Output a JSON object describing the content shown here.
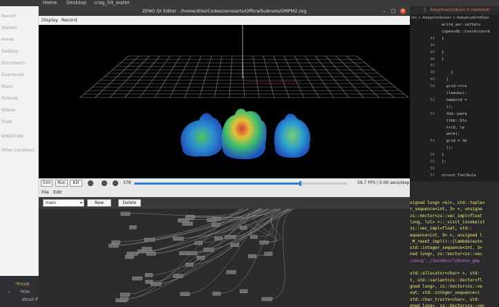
{
  "topbar": {
    "items": [
      "Home",
      "Desktop",
      "crag_hit_water"
    ]
  },
  "file_manager": {
    "places": [
      "Recent",
      "Starred",
      "Home",
      "Desktop",
      "Documents",
      "Downloads",
      "Music",
      "Pictures",
      "Videos",
      "Trash",
      "KINGSTON",
      "Other Locations"
    ],
    "bottom_lines": [
      "\"Primit",
      "Prim",
      "struct P"
    ]
  },
  "zeno_window": {
    "title": "ZENO Qt Editor - /home/dilei/Codes/zeno/arts/OfficialSubnets/GMPM2.zsg",
    "menu": [
      "Display",
      "Record"
    ],
    "timeline": {
      "end_frame": "500",
      "run_label": "Run",
      "kill_label": "Kill",
      "current_frame": "378",
      "progress": 0.78,
      "fps_text": "59.7 FPS | 0.00 secs/step"
    },
    "node_editor": {
      "menu": [
        "File",
        "Edit"
      ],
      "subnet_select": "main",
      "new_label": "New",
      "delete_label": "Delete"
    }
  },
  "code_editor": {
    "tab_title": "AdaptiveGridGen.h (deleted)",
    "breadcrumb": "cts > AdaptiveSolver > AdaptiveGridGen",
    "lines": [
      {
        "num": "",
        "text": "write_axr.setValu"
      },
      {
        "num": "",
        "text": "(openvdb::Coord(coord"
      },
      {
        "num": "43",
        "text": "}"
      },
      {
        "num": "44",
        "text": ""
      },
      {
        "num": "45",
        "text": "}"
      },
      {
        "num": "46",
        "text": "}"
      },
      {
        "num": "47",
        "text": ""
      },
      {
        "num": "48",
        "text": "    }"
      },
      {
        "num": "49",
        "text": "  }"
      },
      {
        "num": "50",
        "text": "  grid->tre"
      },
      {
        "num": "",
        "text": "  (leaves);"
      },
      {
        "num": "51",
        "text": "  tmpGrid ="
      },
      {
        "num": "",
        "text": "  ();"
      },
      {
        "num": "52",
        "text": "  tbb::para"
      },
      {
        "num": "",
        "text": "  (tbb::blo"
      },
      {
        "num": "",
        "text": "  t>(0, le"
      },
      {
        "num": "",
        "text": "  work);"
      },
      {
        "num": "53",
        "text": "  grid = tm"
      },
      {
        "num": "",
        "text": "  ();"
      },
      {
        "num": "54",
        "text": "}"
      },
      {
        "num": "55",
        "text": "};"
      },
      {
        "num": "56",
        "text": ""
      },
      {
        "num": "57",
        "text": "struct ToolRule"
      }
    ]
  },
  "terminal": {
    "lines": [
      {
        "text": "signed long> >&)>, std::tuple<",
        "color": "#e8e8e8"
      },
      {
        "text": "r_sequence<int, 3> >, unsigne",
        "color": "#e8e8e8"
      },
      {
        "text": "zs::Vector<zs::vec_impl<float",
        "color": "#e8e8e8"
      },
      {
        "text": "long, lul> >::_visit_invoke(st",
        "color": "#e8e8e8"
      },
      {
        "text": "zs::vec_impl<float, std::",
        "color": "#e8e8e8"
      },
      {
        "text": "equence<int, 9> >, unsigned l",
        "color": "#e8e8e8"
      },
      {
        "text": "_M_reset_impl()::{lambda(auto",
        "color": "#e8e8e8"
      },
      {
        "text": "std::integer_sequence<int, 3>",
        "color": "#e8e8e8"
      },
      {
        "text": "ned long>, zs::Vector<zs::vec",
        "color": "#e8e8e8"
      },
      {
        "text": "/zenq/../ZenoBin/libzeno_gmp",
        "color": "#c678dd"
      },
      {
        "text": "",
        "color": "#e8e8e8"
      },
      {
        "text": "std::allocator<char> >, std:",
        "color": "#e8e8e8"
      },
      {
        "text": "t, std::variant<zs::Vector<fl",
        "color": "#e8e8e8"
      },
      {
        "text": "gned long>, zs::Vector<zs::ve",
        "color": "#e8e8e8"
      },
      {
        "text": "oat, std::integer_sequence<i",
        "color": "#e8e8e8"
      },
      {
        "text": "std::char_traits<char>, std:",
        "color": "#e8e8e8"
      },
      {
        "text": "gned long>, zs::Vector<zs::vec",
        "color": "#e8e8e8"
      }
    ]
  },
  "colors": {
    "accent_blue": "#2f7fd6",
    "close_orange": "#e4552d",
    "deleted_tab_red": "#e07070",
    "terminal_yellow": "#f2f27a"
  }
}
